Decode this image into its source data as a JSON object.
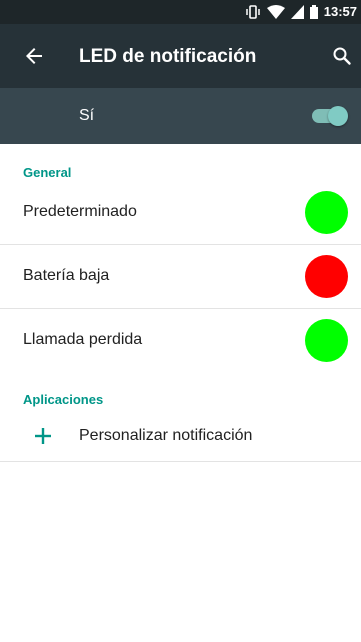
{
  "status_bar": {
    "time": "13:57",
    "icons": [
      "vibrate-icon",
      "wifi-icon",
      "signal-icon",
      "battery-icon"
    ]
  },
  "toolbar": {
    "title": "LED de notificación",
    "back_icon": "arrow-back-icon",
    "search_icon": "search-icon"
  },
  "master_switch": {
    "label": "Sí",
    "on": true
  },
  "sections": [
    {
      "title": "General",
      "items": [
        {
          "label": "Predeterminado",
          "color": "#00ff00"
        },
        {
          "label": "Batería baja",
          "color": "#ff0000"
        },
        {
          "label": "Llamada perdida",
          "color": "#00ff00"
        }
      ]
    },
    {
      "title": "Aplicaciones",
      "items": [
        {
          "label": "Personalizar notificación",
          "icon": "plus-icon"
        }
      ]
    }
  ],
  "colors": {
    "status_bar": "#1e2629",
    "toolbar": "#263238",
    "master_bar": "#37474f",
    "accent": "#009688"
  }
}
